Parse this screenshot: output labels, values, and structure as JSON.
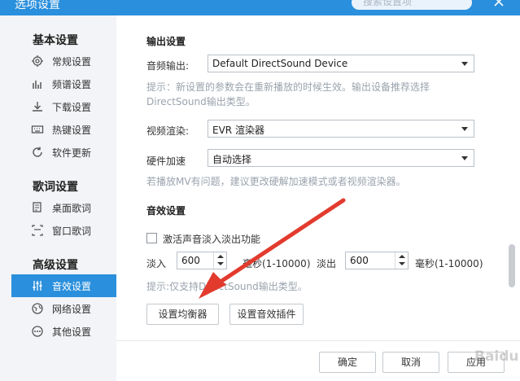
{
  "window": {
    "title": "选项设置",
    "search_placeholder": "搜索设置项",
    "close_icon": "close-icon"
  },
  "sidebar": {
    "sections": [
      {
        "title": "基本设置",
        "items": [
          {
            "label": "常规设置",
            "icon": "gear-icon"
          },
          {
            "label": "频谱设置",
            "icon": "spectrum-icon"
          },
          {
            "label": "下载设置",
            "icon": "download-icon"
          },
          {
            "label": "热键设置",
            "icon": "keyboard-icon"
          },
          {
            "label": "软件更新",
            "icon": "refresh-icon"
          }
        ]
      },
      {
        "title": "歌词设置",
        "items": [
          {
            "label": "桌面歌词",
            "icon": "desktop-lyrics-icon"
          },
          {
            "label": "窗口歌词",
            "icon": "window-lyrics-icon"
          }
        ]
      },
      {
        "title": "高级设置",
        "items": [
          {
            "label": "音效设置",
            "icon": "equalizer-icon",
            "active": true
          },
          {
            "label": "网络设置",
            "icon": "globe-icon"
          },
          {
            "label": "其他设置",
            "icon": "more-icon"
          }
        ]
      }
    ]
  },
  "output": {
    "heading": "输出设置",
    "audio_label": "音频输出:",
    "audio_value": "Default DirectSound Device",
    "hint1_line1": "提示：新设置的参数会在重新播放的时候生效。输出设备推荐选择",
    "hint1_line2": "DirectSound输出类型。",
    "video_label": "视频渲染:",
    "video_value": "EVR 渲染器",
    "hw_label": "硬件加速",
    "hw_value": "自动选择",
    "hint2": "若播放MV有问题，建议更改硬解加速模式或者视频渲染器。"
  },
  "effects": {
    "heading": "音效设置",
    "fade_label": "激活声音淡入淡出功能",
    "fade_checked": false,
    "fadein_label": "淡入",
    "fadein_value": "600",
    "fadein_unit": "毫秒(1-10000)",
    "fadeout_label": "淡出",
    "fadeout_value": "600",
    "fadeout_unit": "毫秒(1-10000)",
    "hint3": "提示:仅支持DirectSound输出类型。",
    "eq_button": "设置均衡器",
    "plugin_button": "设置音效插件"
  },
  "footer": {
    "ok": "确定",
    "cancel": "取消",
    "apply": "应用"
  },
  "watermark": "Baidu 经验",
  "colors": {
    "accent": "#2a8fdc",
    "arrow": "#e23b2e"
  }
}
